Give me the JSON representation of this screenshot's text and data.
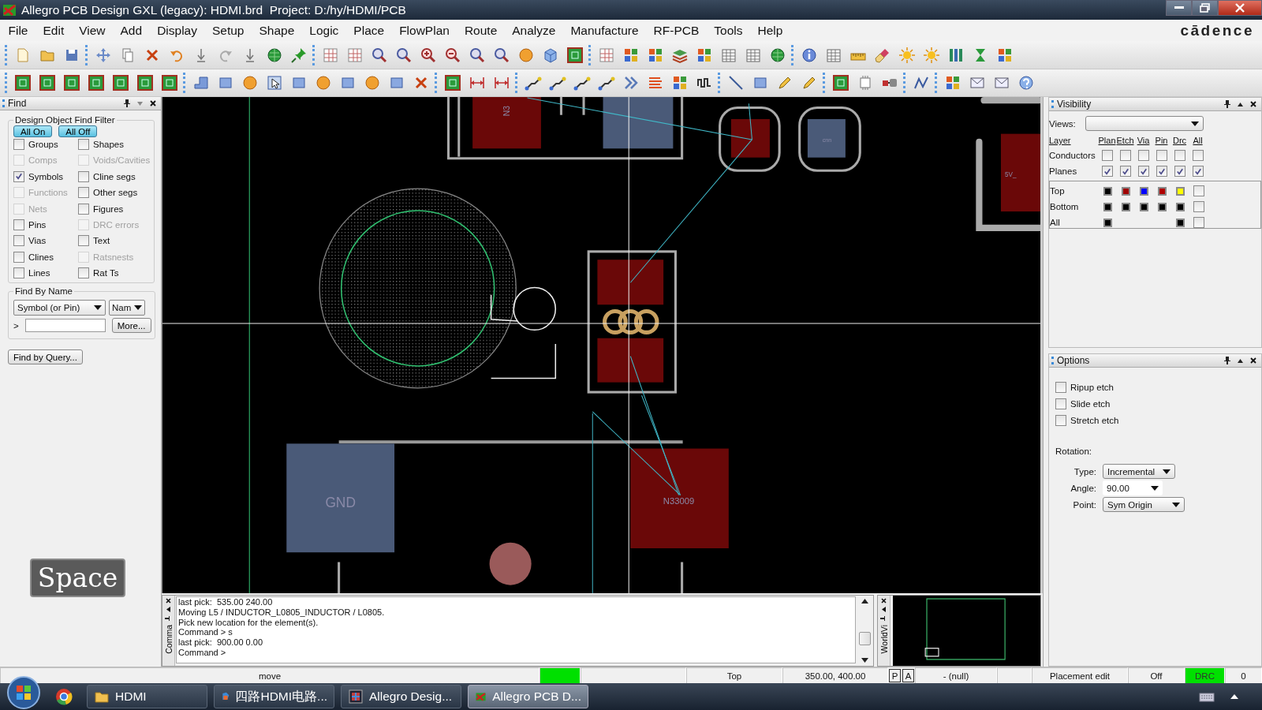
{
  "window": {
    "title": "Allegro PCB Design GXL (legacy): HDMI.brd  Project: D:/hy/HDMI/PCB"
  },
  "menu": [
    "File",
    "Edit",
    "View",
    "Add",
    "Display",
    "Setup",
    "Shape",
    "Logic",
    "Place",
    "FlowPlan",
    "Route",
    "Analyze",
    "Manufacture",
    "RF-PCB",
    "Tools",
    "Help"
  ],
  "brand": "cādence",
  "find": {
    "title": "Find",
    "filter_title": "Design Object Find Filter",
    "buttons": [
      "All On",
      "All Off"
    ],
    "filters": [
      {
        "label": "Groups",
        "checked": false,
        "disabled": false
      },
      {
        "label": "Shapes",
        "checked": false,
        "disabled": false
      },
      {
        "label": "Comps",
        "checked": false,
        "disabled": true
      },
      {
        "label": "Voids/Cavities",
        "checked": false,
        "disabled": true
      },
      {
        "label": "Symbols",
        "checked": true,
        "disabled": false
      },
      {
        "label": "Cline segs",
        "checked": false,
        "disabled": false
      },
      {
        "label": "Functions",
        "checked": false,
        "disabled": true
      },
      {
        "label": "Other segs",
        "checked": false,
        "disabled": false
      },
      {
        "label": "Nets",
        "checked": false,
        "disabled": true
      },
      {
        "label": "Figures",
        "checked": false,
        "disabled": false
      },
      {
        "label": "Pins",
        "checked": false,
        "disabled": false
      },
      {
        "label": "DRC errors",
        "checked": false,
        "disabled": true
      },
      {
        "label": "Vias",
        "checked": false,
        "disabled": false
      },
      {
        "label": "Text",
        "checked": false,
        "disabled": false
      },
      {
        "label": "Clines",
        "checked": false,
        "disabled": false
      },
      {
        "label": "Ratsnests",
        "checked": false,
        "disabled": true
      },
      {
        "label": "Lines",
        "checked": false,
        "disabled": false
      },
      {
        "label": "Rat Ts",
        "checked": false,
        "disabled": false
      }
    ],
    "by_name": {
      "title": "Find By Name",
      "object_type": "Symbol (or Pin)",
      "match": "Nam",
      "prompt": ">",
      "more": "More..."
    },
    "query_button": "Find by Query..."
  },
  "key_overlay": "Space",
  "canvas": {
    "labels": [
      "N3",
      "cnn",
      "5V_",
      "GND",
      "N33009"
    ]
  },
  "command": {
    "tab": "Comma",
    "lines": [
      "last pick:  535.00 240.00",
      "Moving L5 / INDUCTOR_L0805_INDUCTOR / L0805.",
      "Pick new location for the element(s).",
      "Command > s",
      "last pick:  900.00 0.00",
      "Command >"
    ]
  },
  "worldview": {
    "tab": "WorldVi"
  },
  "visibility": {
    "title": "Visibility",
    "views_label": "Views:",
    "columns": [
      "Layer",
      "Plan",
      "Etch",
      "Via",
      "Pin",
      "Drc",
      "All"
    ],
    "groups": [
      {
        "name": "Conductors",
        "checks": [
          false,
          false,
          false,
          false,
          false,
          false
        ]
      },
      {
        "name": "Planes",
        "checks": [
          true,
          true,
          true,
          true,
          true,
          true
        ]
      }
    ],
    "layers": [
      {
        "name": "Top",
        "swatches": [
          {
            "kind": "swatch",
            "color": "#000000"
          },
          {
            "kind": "swatch",
            "color": "#a00000"
          },
          {
            "kind": "swatch",
            "color": "#0000ff"
          },
          {
            "kind": "swatch",
            "color": "#b00000"
          },
          {
            "kind": "swatch",
            "color": "#ffff00"
          }
        ],
        "all": false
      },
      {
        "name": "Bottom",
        "swatches": [
          {
            "kind": "swatch",
            "color": "#000000"
          },
          {
            "kind": "swatch",
            "color": "#000000"
          },
          {
            "kind": "swatch",
            "color": "#000000"
          },
          {
            "kind": "swatch",
            "color": "#000000"
          },
          {
            "kind": "swatch",
            "color": "#000000"
          }
        ],
        "all": false
      },
      {
        "name": "All",
        "swatches": [
          {
            "kind": "swatch",
            "color": "#000000"
          },
          {
            "kind": "blank"
          },
          {
            "kind": "blank"
          },
          {
            "kind": "blank"
          },
          {
            "kind": "swatch",
            "color": "#000000"
          }
        ],
        "all": false
      }
    ]
  },
  "options": {
    "title": "Options",
    "checks": [
      {
        "label": "Ripup etch",
        "checked": false
      },
      {
        "label": "Slide etch",
        "checked": false
      },
      {
        "label": "Stretch etch",
        "checked": false
      }
    ],
    "rotation_label": "Rotation:",
    "fields": [
      {
        "label": "Type:",
        "value": "Incremental",
        "kind": "dropdown"
      },
      {
        "label": "Angle:",
        "value": "90.00",
        "kind": "combo"
      },
      {
        "label": "Point:",
        "value": "Sym Origin",
        "kind": "dropdown"
      }
    ]
  },
  "status_bar": [
    {
      "kind": "text",
      "text": "move"
    },
    {
      "kind": "light",
      "on": true
    },
    {
      "kind": "blank"
    },
    {
      "kind": "text",
      "text": "Top"
    },
    {
      "kind": "text",
      "text": "350.00, 400.00"
    },
    {
      "kind": "toggle",
      "text": "P"
    },
    {
      "kind": "toggle",
      "text": "A"
    },
    {
      "kind": "text",
      "text": "- (null)"
    },
    {
      "kind": "blank"
    },
    {
      "kind": "text",
      "text": "Placement edit"
    },
    {
      "kind": "text",
      "text": "Off"
    },
    {
      "kind": "light_text",
      "text": "DRC",
      "on": true
    },
    {
      "kind": "text",
      "text": "0"
    }
  ],
  "taskbar": {
    "items": [
      {
        "label": "HDMI",
        "kind": "folder",
        "selected": false
      },
      {
        "label": "四路HDMI电路...",
        "kind": "slides",
        "selected": false
      },
      {
        "label": "Allegro Desig...",
        "kind": "app",
        "selected": false
      },
      {
        "label": "Allegro PCB D...",
        "kind": "pcb",
        "selected": true
      }
    ]
  }
}
